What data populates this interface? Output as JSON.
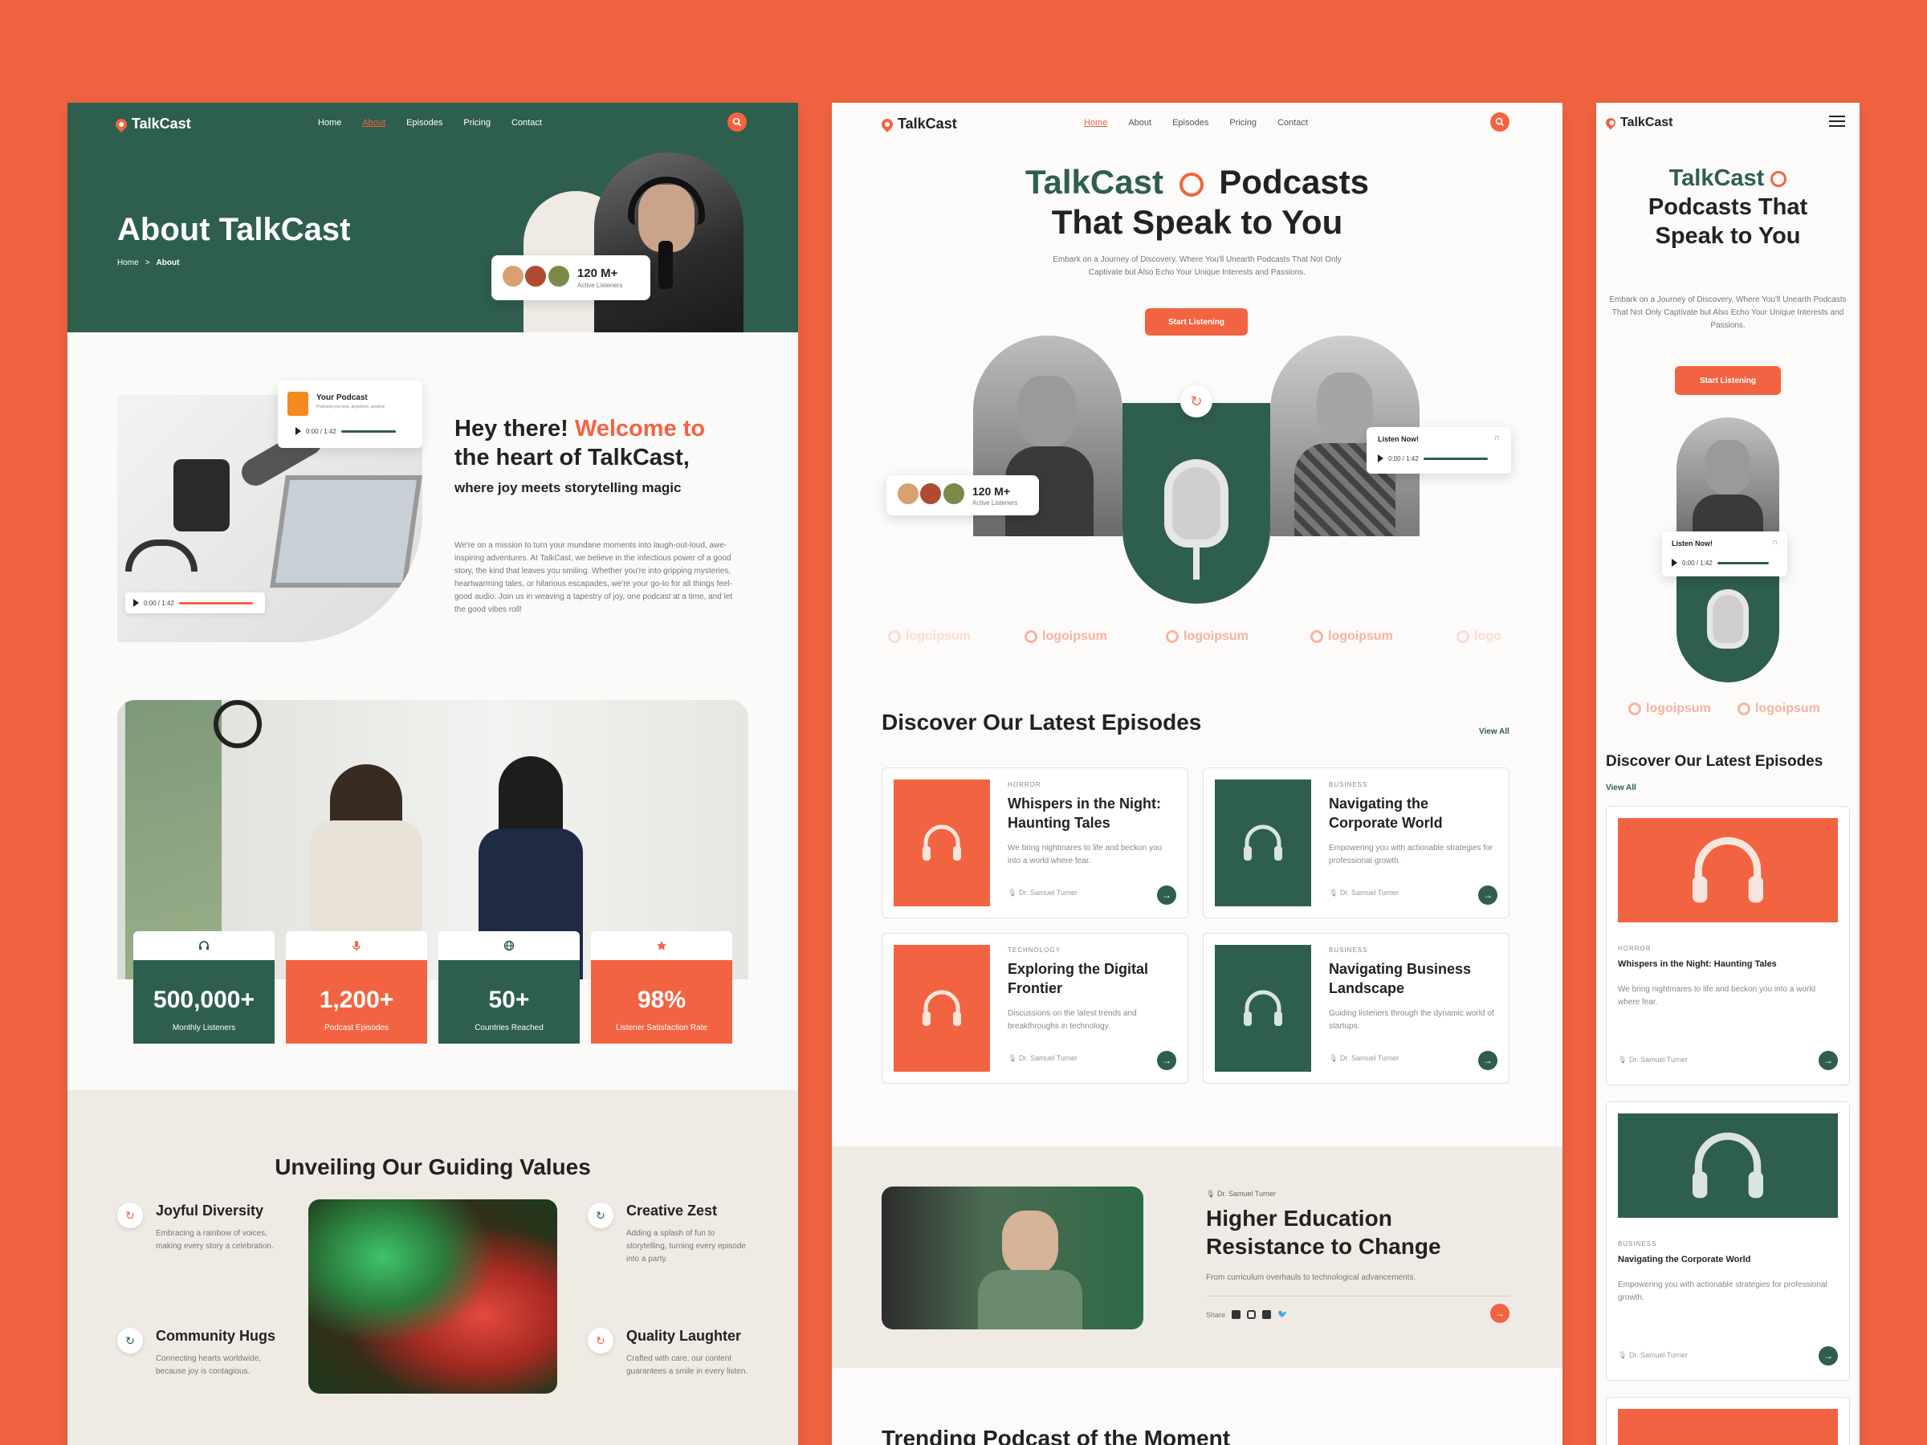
{
  "colors": {
    "accent": "#F26441",
    "brand_green": "#2E5E4E",
    "background": "#F26441",
    "beige": "#EFEBE4"
  },
  "brand": "TalkCast",
  "nav": {
    "home": "Home",
    "about": "About",
    "episodes": "Episodes",
    "pricing": "Pricing",
    "contact": "Contact"
  },
  "about": {
    "hero_title": "About TalkCast",
    "breadcrumb": {
      "home": "Home",
      "sep": ">",
      "current": "About"
    },
    "listeners": {
      "count": "120 M+",
      "label": "Active Listeners"
    },
    "podcast_card": {
      "title": "Your Podcast",
      "subtitle": "Podcasts you love, anywhere, anytime",
      "time": "0:00 / 1:42"
    },
    "player_time": "0:00 / 1:42",
    "welcome": {
      "part1": "Hey there! ",
      "part2": "Welcome to",
      "line2": "the heart of TalkCast,",
      "tagline": "where joy meets storytelling magic",
      "body": "We're on a mission to turn your mundane moments into laugh-out-loud, awe-inspiring adventures. At TalkCast, we believe in the infectious power of a good story, the kind that leaves you smiling. Whether you're into gripping mysteries, heartwarming tales, or hilarious escapades, we're your go-to for all things feel-good audio. Join us in weaving a tapestry of joy, one podcast at a time, and let the good vibes roll!"
    },
    "stats": [
      {
        "value": "500,000+",
        "label": "Monthly Listeners",
        "icon": "headphones-icon"
      },
      {
        "value": "1,200+",
        "label": "Podcast Episodes",
        "icon": "microphone-icon"
      },
      {
        "value": "50+",
        "label": "Countries Reached",
        "icon": "globe-icon"
      },
      {
        "value": "98%",
        "label": "Listener Satisfaction Rate",
        "icon": "star-icon"
      }
    ],
    "values_title": "Unveiling Our Guiding Values",
    "values": [
      {
        "title": "Joyful Diversity",
        "desc": "Embracing a rainbow of voices, making every story a celebration."
      },
      {
        "title": "Community Hugs",
        "desc": "Connecting hearts worldwide, because joy is contagious."
      },
      {
        "title": "Creative Zest",
        "desc": "Adding a splash of fun to storytelling, turning every episode into a party."
      },
      {
        "title": "Quality Laughter",
        "desc": "Crafted with care, our content guarantees a smile in every listen."
      }
    ]
  },
  "home": {
    "hero_title_brand": "TalkCast",
    "hero_title_word": "Podcasts",
    "hero_title_line2": "That Speak to You",
    "hero_desc": "Embark on a Journey of Discovery, Where You'll Unearth Podcasts That Not Only Captivate but Also Echo Your Unique Interests and Passions.",
    "cta": "Start Listening",
    "listeners": {
      "count": "120 M+",
      "label": "Active Listeners"
    },
    "listen_now": {
      "title": "Listen Now!",
      "time": "0:00 / 1:42"
    },
    "logos": [
      "logoipsum",
      "logoipsum",
      "logoipsum",
      "logoipsum",
      "logo"
    ],
    "episodes_title": "Discover Our Latest Episodes",
    "view_all": "View All",
    "episodes": [
      {
        "category": "HORROR",
        "title": "Whispers in the Night: Haunting Tales",
        "desc": "We bring nightmares to life and beckon you into a world where fear.",
        "author": "Dr. Samuel Turner",
        "color": "#F26441"
      },
      {
        "category": "BUSINESS",
        "title": "Navigating the Corporate World",
        "desc": "Empowering you with actionable strategies for professional growth.",
        "author": "Dr. Samuel Turner",
        "color": "#2E5E4E"
      },
      {
        "category": "TECHNOLOGY",
        "title": "Exploring the Digital Frontier",
        "desc": "Discussions on the latest trends and breakthroughs in technology.",
        "author": "Dr. Samuel Turner",
        "color": "#F26441"
      },
      {
        "category": "BUSINESS",
        "title": "Navigating Business Landscape",
        "desc": "Guiding listeners through the dynamic world of startups.",
        "author": "Dr. Samuel Turner",
        "color": "#2E5E4E"
      }
    ],
    "featured": {
      "author": "Dr. Samuel Turner",
      "title": "Higher Education Resistance to Change",
      "desc": "From curriculum overhauls to technological advancements.",
      "share": "Share"
    },
    "trending_title": "Trending Podcast of the Moment"
  },
  "mobile": {
    "hero_title_brand": "TalkCast",
    "hero_title_rest": "Podcasts That Speak to You",
    "hero_desc": "Embark on a Journey of Discovery, Where You'll Unearth Podcasts That Not Only Captivate but Also Echo Your Unique Interests and Passions.",
    "cta": "Start Listening",
    "listen_now": {
      "title": "Listen Now!",
      "time": "0:00 / 1:42"
    },
    "logos": [
      "logoipsum",
      "logoipsum"
    ],
    "episodes_title": "Discover Our Latest Episodes",
    "view_all": "View All",
    "episodes": [
      {
        "category": "HORROR",
        "title": "Whispers in the Night: Haunting Tales",
        "desc": "We bring nightmares to life and beckon you into a world where fear.",
        "author": "Dr. Samuel Turner",
        "color": "#F26441"
      },
      {
        "category": "BUSINESS",
        "title": "Navigating the Corporate World",
        "desc": "Empowering you with actionable strategies for professional growth.",
        "author": "Dr. Samuel Turner",
        "color": "#2E5E4E"
      }
    ]
  }
}
